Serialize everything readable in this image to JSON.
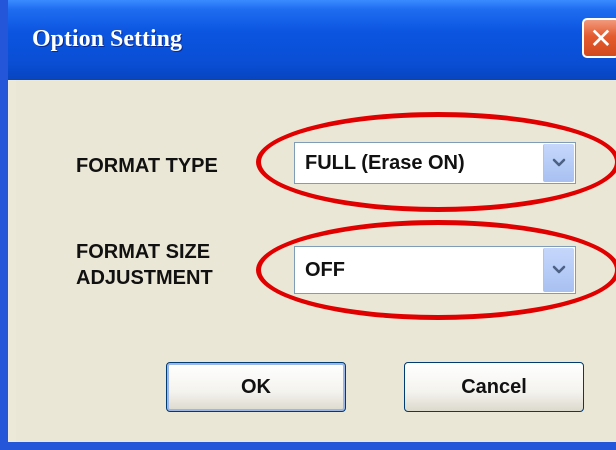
{
  "window": {
    "title": "Option Setting",
    "close_glyph": "✕",
    "colors": {
      "titlebar": "#0a4ed4",
      "close": "#e35b2f",
      "highlight": "#e00000"
    }
  },
  "form": {
    "format_type_label": "FORMAT TYPE",
    "format_type_value": "FULL (Erase ON)",
    "format_size_label_line1": "FORMAT SIZE",
    "format_size_label_line2": "ADJUSTMENT",
    "format_size_value": "OFF"
  },
  "buttons": {
    "ok_label": "OK",
    "cancel_label": "Cancel"
  },
  "icons": {
    "close": "close-icon",
    "dropdown": "chevron-down-icon"
  }
}
